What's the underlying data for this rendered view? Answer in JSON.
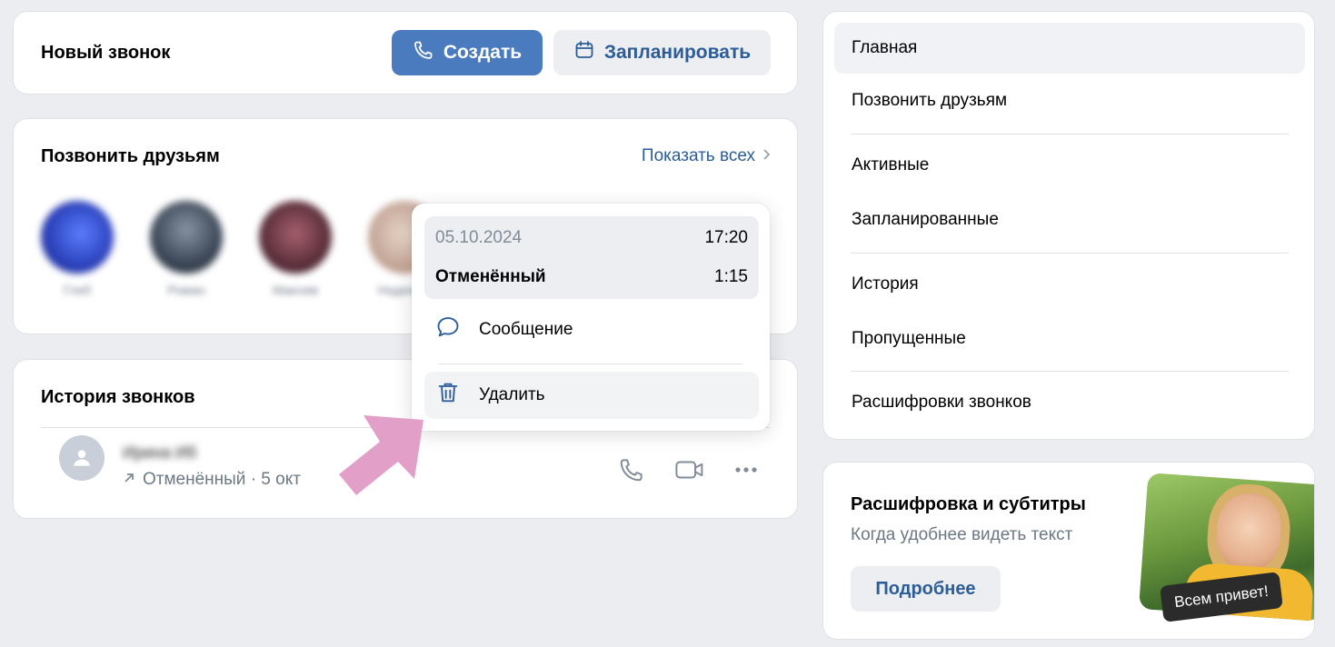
{
  "new_call": {
    "title": "Новый звонок",
    "create_label": "Создать",
    "schedule_label": "Запланировать"
  },
  "friends": {
    "title": "Позвонить друзьям",
    "show_all": "Показать всех",
    "items": [
      {
        "name": "Глеб",
        "color": "#2f4fd6"
      },
      {
        "name": "Роман",
        "color": "#4a5566"
      },
      {
        "name": "Максим",
        "color": "#6b3b4a"
      },
      {
        "name": "Надежда",
        "color": "#c9b1a4"
      }
    ]
  },
  "history": {
    "title": "История звонков",
    "call": {
      "name": "Ирина Иб",
      "status": "Отменённый · 5 окт"
    }
  },
  "popup": {
    "date": "05.10.2024",
    "time": "17:20",
    "status": "Отменённый",
    "duration": "1:15",
    "message_label": "Сообщение",
    "delete_label": "Удалить"
  },
  "nav": {
    "items": [
      {
        "label": "Главная",
        "active": true
      },
      {
        "label": "Позвонить друзьям"
      },
      {
        "label": "Активные"
      },
      {
        "label": "Запланированные"
      },
      {
        "label": "История"
      },
      {
        "label": "Пропущенные"
      },
      {
        "label": "Расшифровки звонков"
      }
    ]
  },
  "promo": {
    "title": "Расшифровка и субтитры",
    "subtitle": "Когда удобнее видеть текст",
    "button": "Подробнее",
    "image_caption": "Всем привет!"
  },
  "colors": {
    "accent": "#4a7bbf",
    "link": "#2c5d99",
    "annotation_arrow": "#e2a0c8"
  }
}
